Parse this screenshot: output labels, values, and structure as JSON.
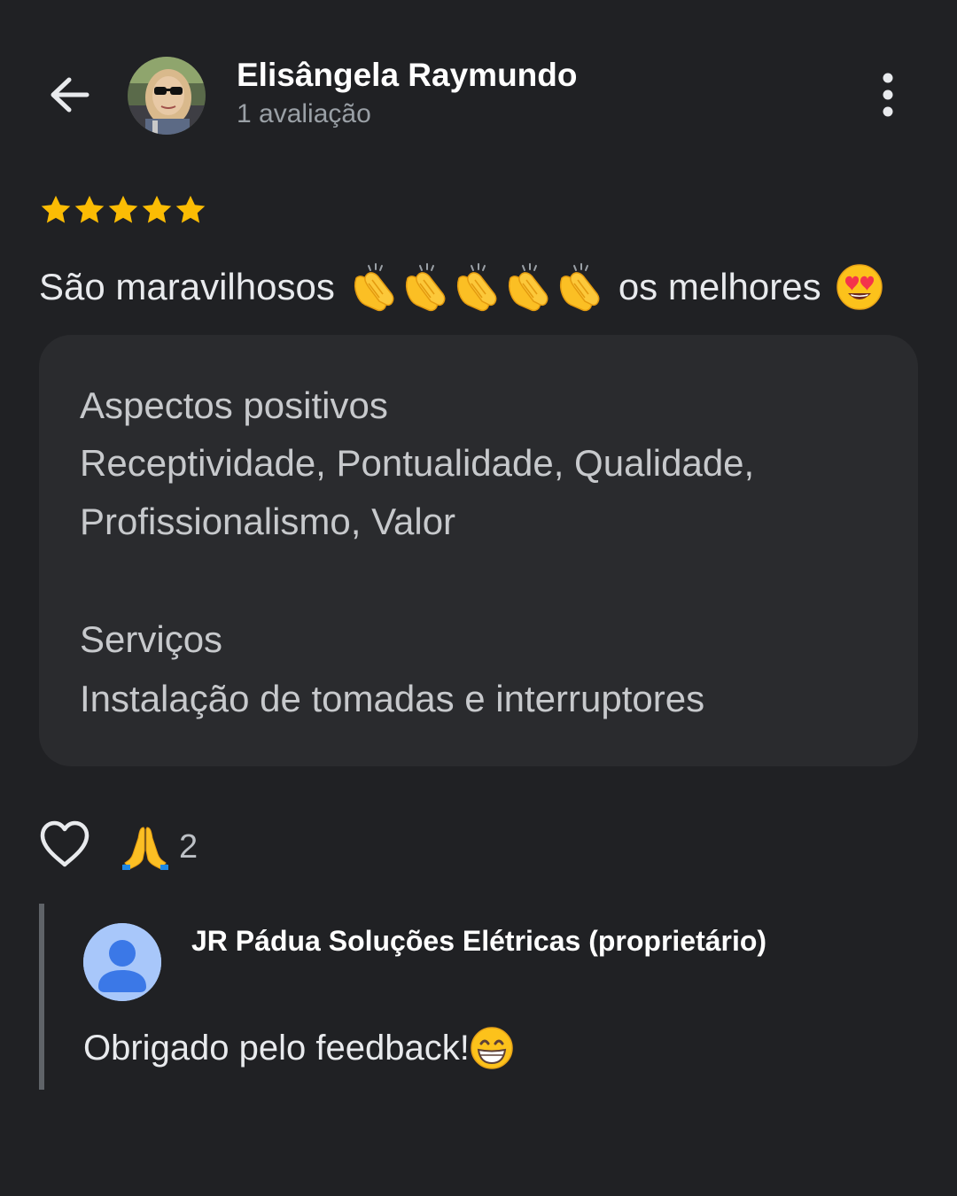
{
  "header": {
    "reviewer_name": "Elisângela Raymundo",
    "reviewer_subtitle": "1 avaliação",
    "back_icon": "arrow-back-icon",
    "more_icon": "more-vert-icon"
  },
  "rating": {
    "stars": 5,
    "max": 5,
    "star_color": "#fbbc04"
  },
  "review": {
    "text_start": "São maravilhosos",
    "text_end": "os melhores",
    "emoji_clap_count": 5
  },
  "details": {
    "sections": [
      {
        "heading": "Aspectos positivos",
        "lines": [
          "Receptividade, Pontualidade, Qualidade,",
          "Profissionalismo, Valor"
        ]
      },
      {
        "heading": "Serviços",
        "lines": [
          "Instalação de tomadas e interruptores"
        ]
      }
    ]
  },
  "reactions": {
    "like_icon": "heart-outline-icon",
    "emoji": "folded-hands",
    "count": "2"
  },
  "owner_reply": {
    "name": "JR Pádua Soluções Elétricas (proprietário)",
    "text": "Obrigado pelo feedback!",
    "avatar_color": "#a8c7fa",
    "avatar_icon": "person-icon"
  }
}
